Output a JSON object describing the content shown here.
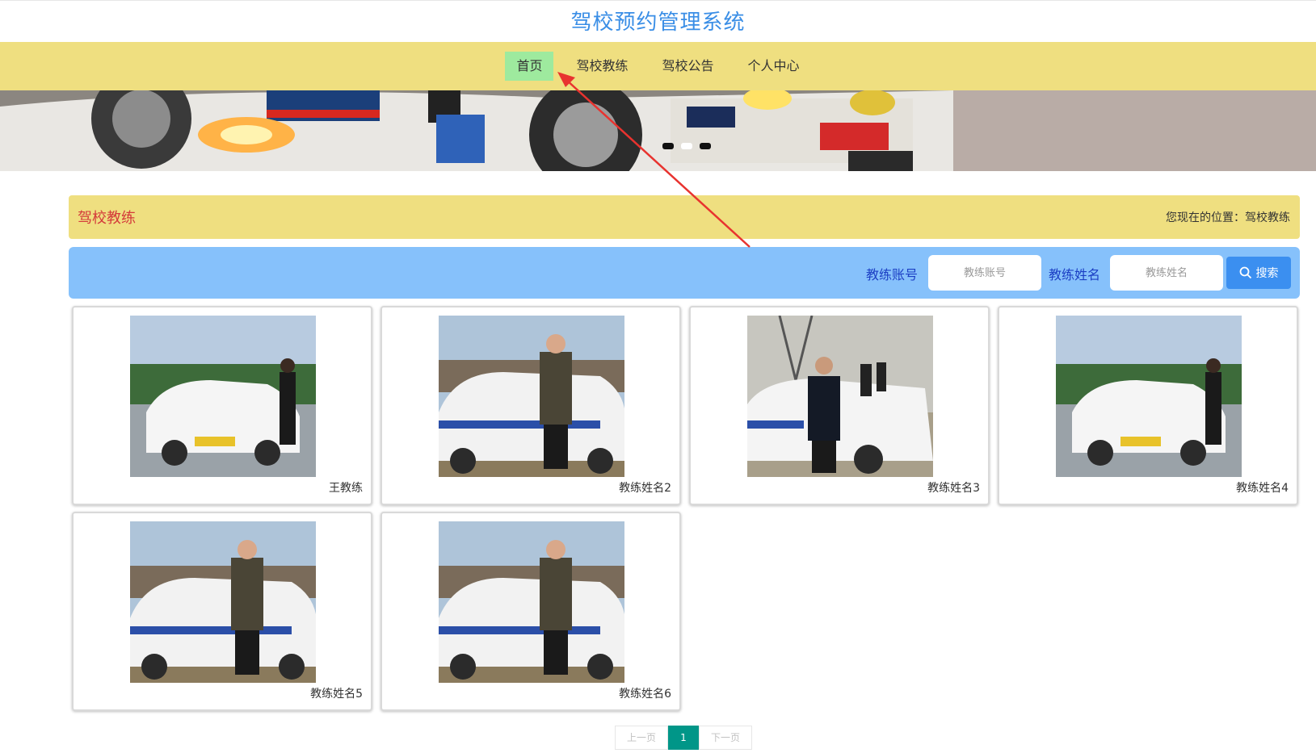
{
  "site": {
    "title": "驾校预约管理系统"
  },
  "nav": {
    "items": [
      {
        "label": "首页",
        "active": true
      },
      {
        "label": "驾校教练",
        "active": false
      },
      {
        "label": "驾校公告",
        "active": false
      },
      {
        "label": "个人中心",
        "active": false
      }
    ]
  },
  "banner": {
    "image": "racing-car-photo",
    "dots": 3,
    "active_dot": 2
  },
  "section": {
    "title": "驾校教练",
    "breadcrumb": "您现在的位置：驾校教练"
  },
  "search": {
    "account_label": "教练账号",
    "account_placeholder": "教练账号",
    "name_label": "教练姓名",
    "name_placeholder": "教练姓名",
    "button_label": "搜索",
    "button_icon": "search-icon"
  },
  "coaches": [
    {
      "name": "王教练",
      "photo": "coach-car-photo-a"
    },
    {
      "name": "教练姓名2",
      "photo": "coach-car-photo-b"
    },
    {
      "name": "教练姓名3",
      "photo": "coach-car-photo-c"
    },
    {
      "name": "教练姓名4",
      "photo": "coach-car-photo-a"
    },
    {
      "name": "教练姓名5",
      "photo": "coach-car-photo-b"
    },
    {
      "name": "教练姓名6",
      "photo": "coach-car-photo-b"
    }
  ],
  "pagination": {
    "prev_label": "上一页",
    "current": "1",
    "next_label": "下一页"
  },
  "colors": {
    "title": "#3a8ee6",
    "nav_bg": "#efdf80",
    "nav_active": "#9eea9e",
    "section_title": "#d43a3a",
    "search_bg": "#86c1fb",
    "search_button": "#3b8ff0",
    "pager_active": "#009688",
    "annotation_arrow": "#e8332f"
  }
}
